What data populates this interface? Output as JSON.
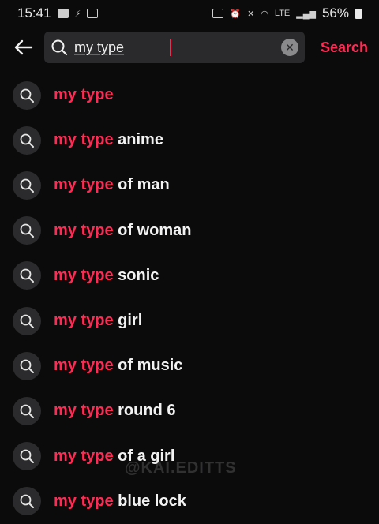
{
  "status_bar": {
    "time": "15:41",
    "battery": "56%",
    "network": "LTE"
  },
  "search": {
    "query": "my type",
    "placeholder": "Search",
    "search_label": "Search"
  },
  "suggestions": [
    {
      "highlight": "my type",
      "rest": ""
    },
    {
      "highlight": "my type",
      "rest": " anime"
    },
    {
      "highlight": "my type",
      "rest": " of man"
    },
    {
      "highlight": "my type",
      "rest": " of woman"
    },
    {
      "highlight": "my type",
      "rest": " sonic"
    },
    {
      "highlight": "my type",
      "rest": " girl"
    },
    {
      "highlight": "my type",
      "rest": " of music"
    },
    {
      "highlight": "my type",
      "rest": " round 6"
    },
    {
      "highlight": "my type",
      "rest": " of a girl"
    },
    {
      "highlight": "my type",
      "rest": " blue lock"
    }
  ],
  "watermark": "@KAI.EDITTS",
  "colors": {
    "accent": "#fe2c55",
    "background": "#0b0b0c",
    "search_bg": "#2a2a2c"
  }
}
